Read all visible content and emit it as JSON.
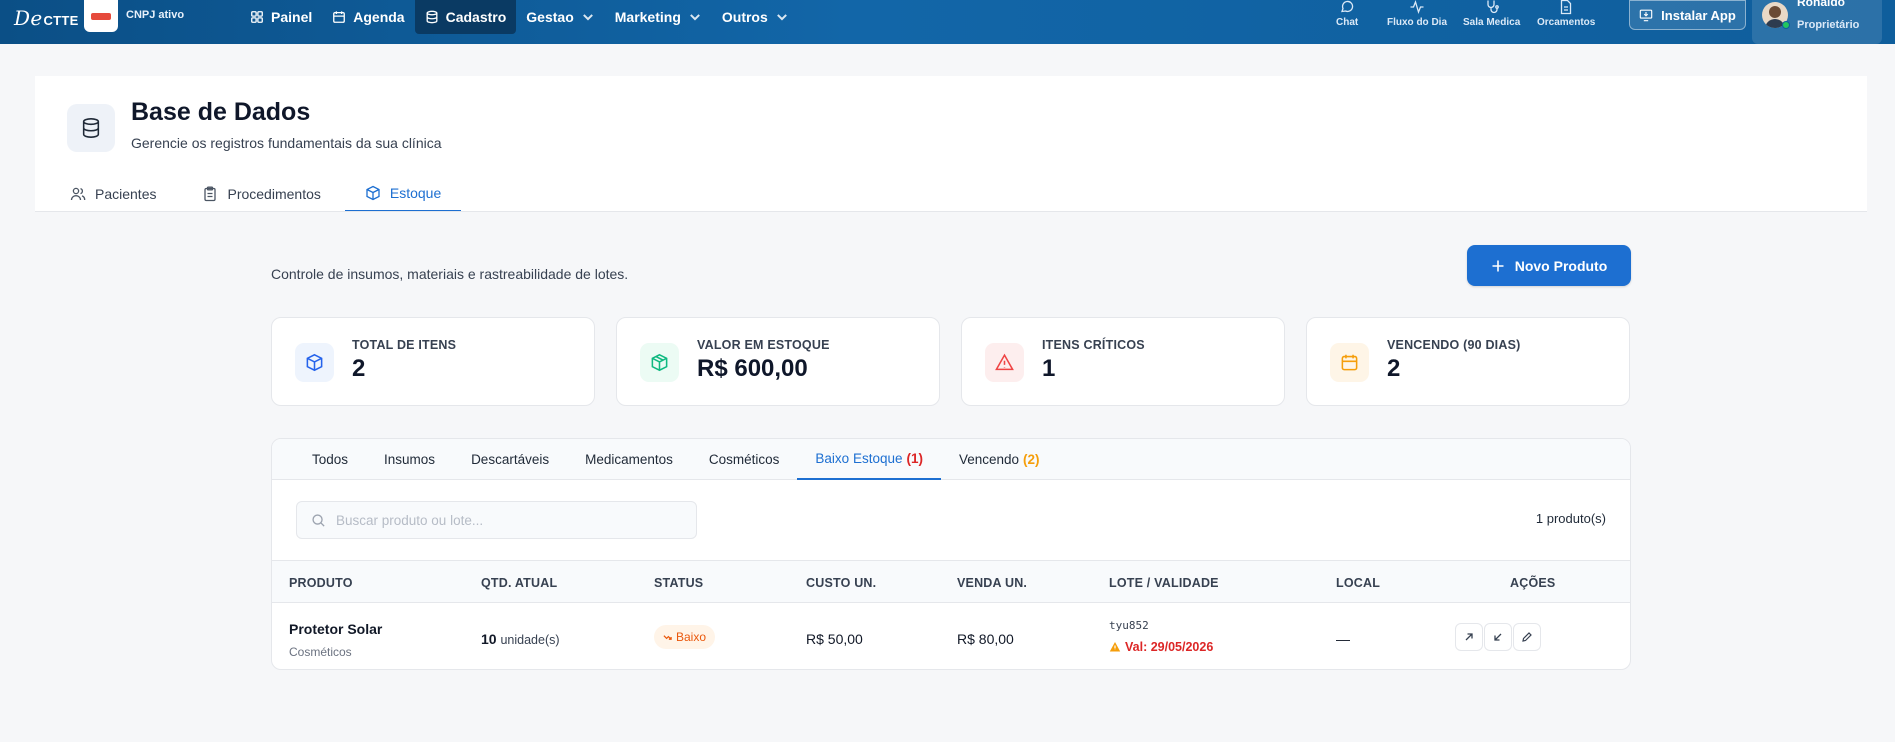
{
  "topbar": {
    "brand_script": "De",
    "brand_text": "CTTE",
    "cnpj_status": "CNPJ ativo",
    "nav": [
      {
        "label": "Painel",
        "icon": "grid-icon"
      },
      {
        "label": "Agenda",
        "icon": "calendar-icon"
      },
      {
        "label": "Cadastro",
        "icon": "database-icon",
        "active": true
      },
      {
        "label": "Gestao",
        "dropdown": true
      },
      {
        "label": "Marketing",
        "dropdown": true
      },
      {
        "label": "Outros",
        "dropdown": true
      }
    ],
    "quick_links": [
      {
        "label": "Chat",
        "icon": "chat-icon"
      },
      {
        "label": "Fluxo do Dia",
        "icon": "activity-icon"
      },
      {
        "label": "Sala Medica",
        "icon": "stethoscope-icon"
      },
      {
        "label": "Orcamentos",
        "icon": "document-icon"
      }
    ],
    "install_label": "Instalar App",
    "user": {
      "name": "Ronaldo",
      "role": "Proprietário"
    }
  },
  "header": {
    "title": "Base de Dados",
    "subtitle": "Gerencie os registros fundamentais da sua clínica",
    "tabs": [
      {
        "label": "Pacientes",
        "icon": "users-icon"
      },
      {
        "label": "Procedimentos",
        "icon": "clipboard-icon"
      },
      {
        "label": "Estoque",
        "icon": "box-icon",
        "active": true
      }
    ]
  },
  "content": {
    "intro": "Controle de insumos, materiais e rastreabilidade de lotes.",
    "new_button": "Novo Produto",
    "stats": [
      {
        "label": "TOTAL DE ITENS",
        "value": "2",
        "icon": "box-icon",
        "color": "#2563eb",
        "bg": "#eef4fd"
      },
      {
        "label": "VALOR EM ESTOQUE",
        "value": "R$ 600,00",
        "icon": "package-icon",
        "color": "#10b981",
        "bg": "#ecfbf4"
      },
      {
        "label": "ITENS CRÍTICOS",
        "value": "1",
        "icon": "alert-triangle-icon",
        "color": "#ef4444",
        "bg": "#fdeeee"
      },
      {
        "label": "VENCENDO (90 DIAS)",
        "value": "2",
        "icon": "calendar-icon",
        "color": "#f59e0b",
        "bg": "#fef5e7"
      }
    ],
    "filter_tabs": [
      {
        "label": "Todos"
      },
      {
        "label": "Insumos"
      },
      {
        "label": "Descartáveis"
      },
      {
        "label": "Medicamentos"
      },
      {
        "label": "Cosméticos"
      },
      {
        "label": "Baixo Estoque",
        "count": "(1)",
        "active": true
      },
      {
        "label": "Vencendo",
        "count": "(2)"
      }
    ],
    "search_placeholder": "Buscar produto ou lote...",
    "product_count": "1 produto(s)",
    "columns": [
      "PRODUTO",
      "QTD. ATUAL",
      "STATUS",
      "CUSTO UN.",
      "VENDA UN.",
      "LOTE / VALIDADE",
      "LOCAL",
      "AÇÕES"
    ],
    "rows": [
      {
        "name": "Protetor Solar",
        "category": "Cosméticos",
        "qty": "10",
        "unit": "unidade(s)",
        "status": "Baixo",
        "cost": "R$ 50,00",
        "sale": "R$ 80,00",
        "lot": "tyu852",
        "validity": "Val: 29/05/2026",
        "local": "—"
      }
    ]
  }
}
